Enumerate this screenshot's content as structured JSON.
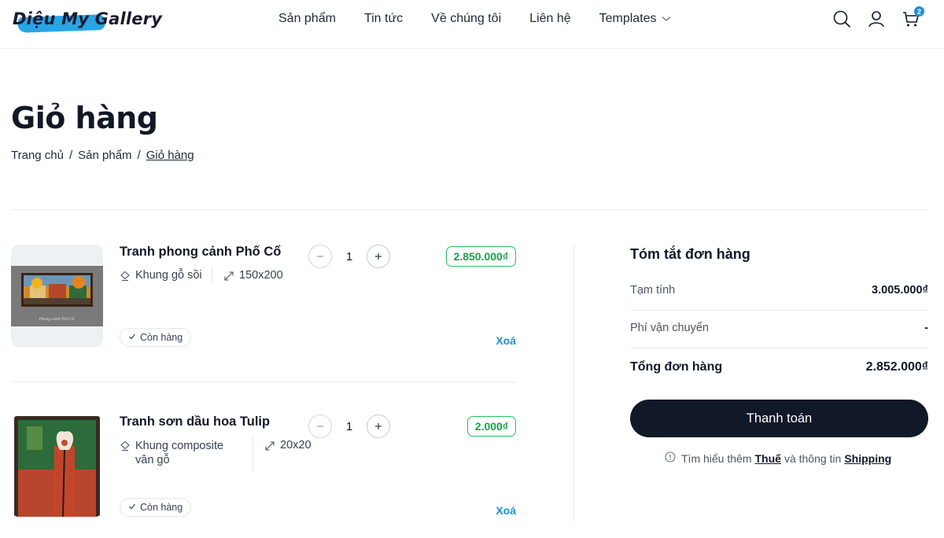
{
  "header": {
    "logo_text": "Diệu My Gallery",
    "nav": [
      {
        "label": "Sản phẩm"
      },
      {
        "label": "Tin tức"
      },
      {
        "label": "Về chúng tôi"
      },
      {
        "label": "Liên hệ"
      },
      {
        "label": "Templates"
      }
    ],
    "cart_count": "2"
  },
  "page": {
    "title": "Giỏ hàng",
    "breadcrumb": [
      "Trang chủ",
      "Sản phẩm",
      "Giỏ hàng"
    ]
  },
  "cart": {
    "items": [
      {
        "name": "Tranh phong cảnh Phố Cổ",
        "frame": "Khung gỗ sồi",
        "size": "150x200",
        "quantity": "1",
        "price": "2.850.000₫",
        "stock": "Còn hàng",
        "remove_label": "Xoá",
        "painting_caption": "Phong cảnh Phố Cổ"
      },
      {
        "name": "Tranh sơn dầu hoa Tulip",
        "frame": "Khung composite vân gỗ",
        "size": "20x20",
        "quantity": "1",
        "price": "2.000₫",
        "stock": "Còn hàng",
        "remove_label": "Xoá"
      }
    ]
  },
  "summary": {
    "title": "Tóm tắt đơn hàng",
    "subtotal_label": "Tạm tính",
    "subtotal_value": "3.005.000₫",
    "shipping_label": "Phí vận chuyển",
    "shipping_value": "-",
    "total_label": "Tổng đơn hàng",
    "total_value": "2.852.000₫",
    "checkout_label": "Thanh toán",
    "info_prefix": "Tìm hiểu thêm",
    "info_tax_link": "Thuế",
    "info_mid": "và thông tin",
    "info_shipping_link": "Shipping"
  },
  "colors": {
    "accent": "#1f8fd6",
    "price_green": "#16a34a",
    "dark": "#111827"
  }
}
